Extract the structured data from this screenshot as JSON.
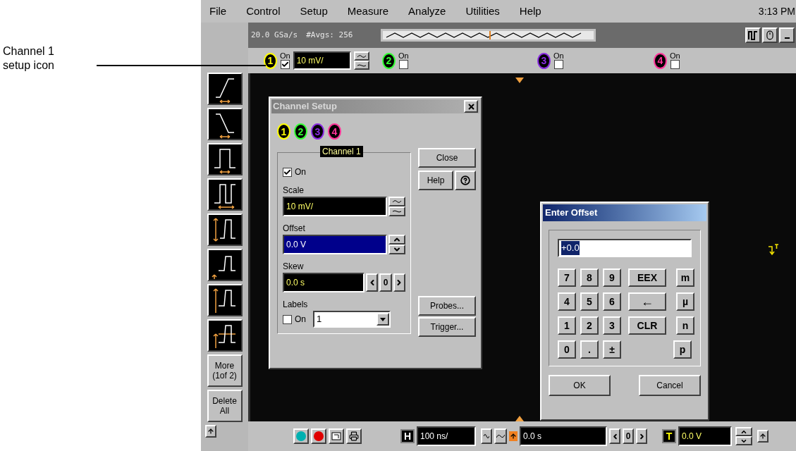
{
  "annotation": "Channel 1 setup icon",
  "menu": [
    "File",
    "Control",
    "Setup",
    "Measure",
    "Analyze",
    "Utilities",
    "Help"
  ],
  "clock": "3:13 PM",
  "status": {
    "sample_rate": "20.0 GSa/s",
    "averages": "#Avgs: 256"
  },
  "channels": [
    {
      "number": "1",
      "color": "#ffff00",
      "on_label": "On",
      "on": true,
      "scale": "10 mV/"
    },
    {
      "number": "2",
      "color": "#33ff33",
      "on_label": "On",
      "on": false
    },
    {
      "number": "3",
      "color": "#8a2be2",
      "on_label": "On",
      "on": false
    },
    {
      "number": "4",
      "color": "#ff3399",
      "on_label": "On",
      "on": false
    }
  ],
  "side_buttons": [
    "More (1of 2)",
    "Delete All"
  ],
  "channel_setup": {
    "title": "Channel Setup",
    "channel_tabs": [
      {
        "number": "1",
        "color": "#ffff00"
      },
      {
        "number": "2",
        "color": "#33ff33"
      },
      {
        "number": "3",
        "color": "#8a2be2"
      },
      {
        "number": "4",
        "color": "#ff3399"
      }
    ],
    "group_label": "Channel 1",
    "on_label": "On",
    "on": true,
    "scale_label": "Scale",
    "scale": "10 mV/",
    "offset_label": "Offset",
    "offset": "0.0 V",
    "skew_label": "Skew",
    "skew": "0.0 s",
    "skew_step": "0",
    "labels_label": "Labels",
    "labels_on_label": "On",
    "labels_on": false,
    "label_value": "1",
    "close": "Close",
    "help": "Help",
    "probes": "Probes...",
    "trigger": "Trigger..."
  },
  "enter_offset": {
    "title": "Enter Offset",
    "value": "+0.0",
    "rows": [
      [
        {
          "label": "7",
          "kind": "digit"
        },
        {
          "label": "8",
          "kind": "digit"
        },
        {
          "label": "9",
          "kind": "digit"
        },
        {
          "label": "EEX",
          "kind": "function"
        },
        {
          "label": "m",
          "kind": "unit"
        }
      ],
      [
        {
          "label": "4",
          "kind": "digit"
        },
        {
          "label": "5",
          "kind": "digit"
        },
        {
          "label": "6",
          "kind": "digit"
        },
        {
          "label": "←",
          "kind": "function"
        },
        {
          "label": "µ",
          "kind": "unit"
        }
      ],
      [
        {
          "label": "1",
          "kind": "digit"
        },
        {
          "label": "2",
          "kind": "digit"
        },
        {
          "label": "3",
          "kind": "digit"
        },
        {
          "label": "CLR",
          "kind": "function"
        },
        {
          "label": "n",
          "kind": "unit"
        }
      ],
      [
        {
          "label": "0",
          "kind": "digit"
        },
        {
          "label": ".",
          "kind": "digit"
        },
        {
          "label": "±",
          "kind": "digit"
        },
        {
          "label": "p",
          "kind": "unit"
        }
      ]
    ],
    "ok": "OK",
    "cancel": "Cancel"
  },
  "horizontal": {
    "label": "H",
    "scale": "100 ns/",
    "position": "0.0 s",
    "step": "0"
  },
  "trigger": {
    "label": "T",
    "level": "0.0 V"
  }
}
